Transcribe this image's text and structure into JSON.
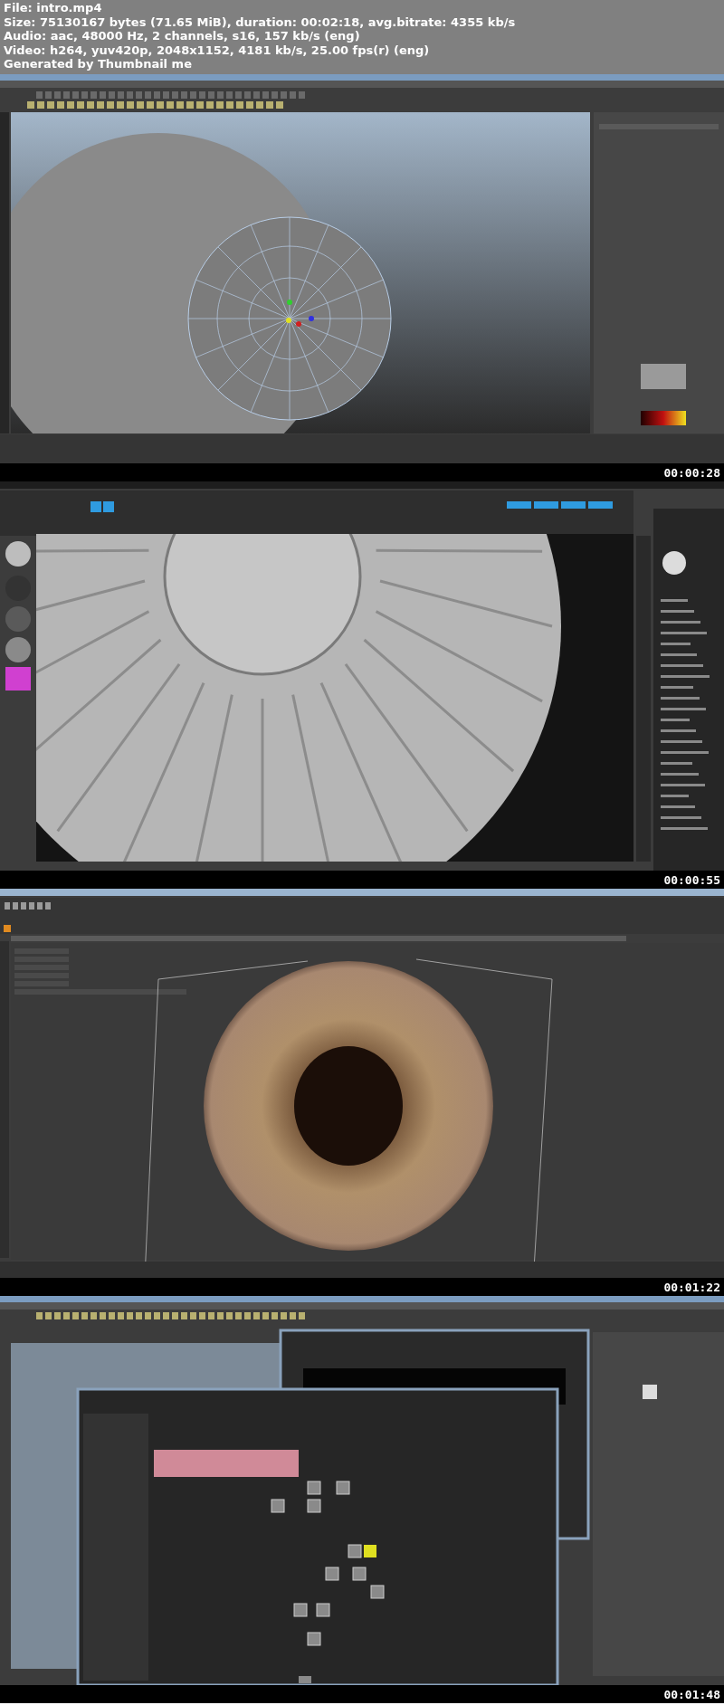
{
  "header": {
    "lines": [
      "File: intro.mp4",
      "Size: 75130167 bytes (71.65 MiB), duration: 00:02:18, avg.bitrate: 4355 kb/s",
      "Audio: aac, 48000 Hz, 2 channels, s16, 157 kb/s (eng)",
      "Video: h264, yuv420p, 2048x1152, 4181 kb/s, 25.00 fps(r) (eng)",
      "Generated by Thumbnail me"
    ]
  },
  "frames": [
    {
      "kind": "modeler",
      "timestamp": "00:00:28"
    },
    {
      "kind": "sculpt",
      "timestamp": "00:00:55"
    },
    {
      "kind": "paint",
      "timestamp": "00:01:22"
    },
    {
      "kind": "shading",
      "timestamp": "00:01:48"
    }
  ]
}
